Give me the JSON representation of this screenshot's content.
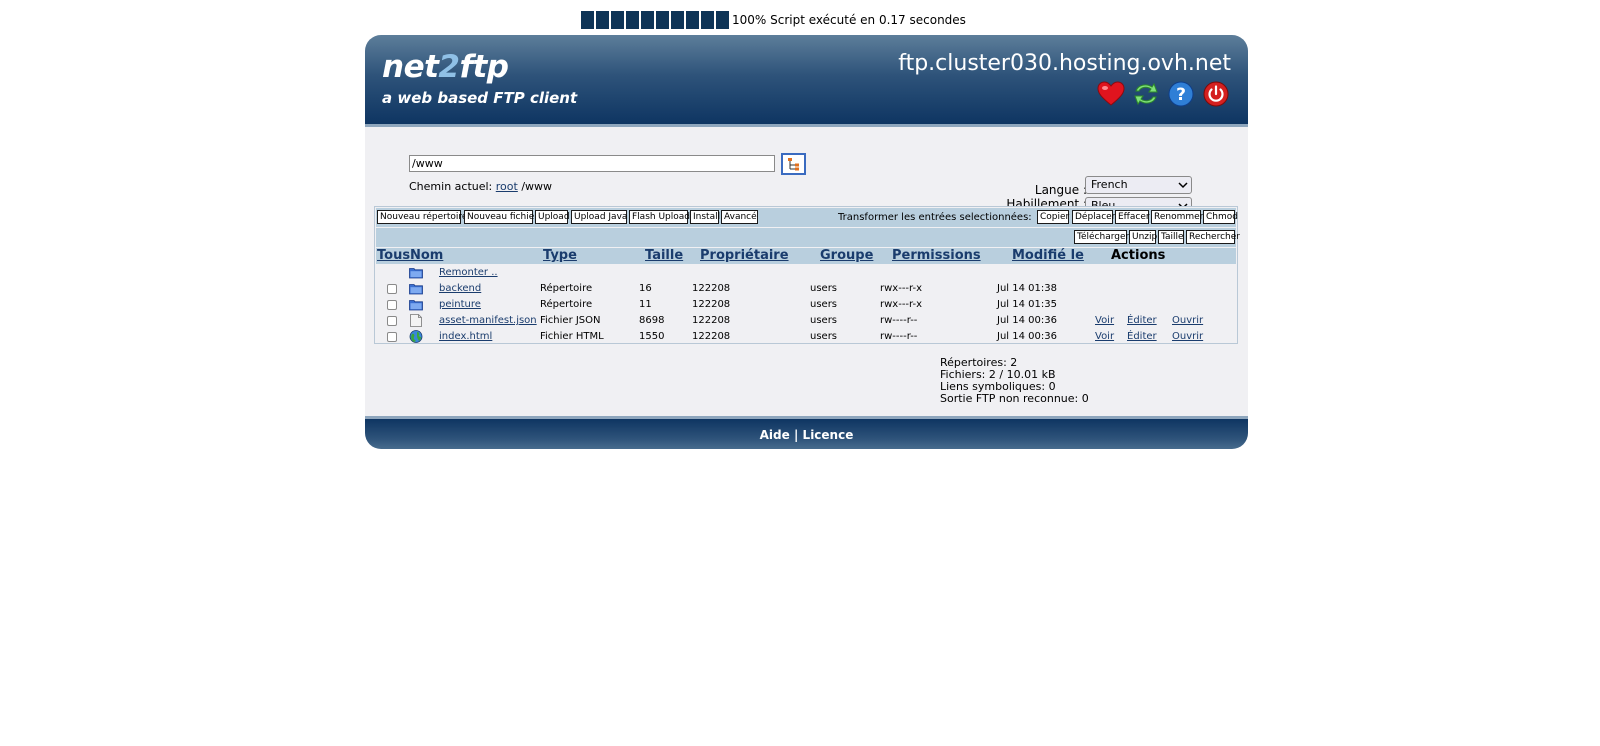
{
  "progress": {
    "blocks": 10,
    "percent_text": "100%",
    "message": "Script exécuté en 0.17 secondes"
  },
  "header": {
    "logo_part1": "net",
    "logo_part2": "2",
    "logo_part3": "ftp",
    "tagline": "a web based FTP client",
    "host": "ftp.cluster030.hosting.ovh.net",
    "icons": [
      "heart-icon",
      "refresh-icon",
      "help-icon",
      "power-icon"
    ]
  },
  "nav": {
    "path_value": "/www",
    "current_path_label": "Chemin actuel:",
    "current_path_root": "root",
    "current_path_rest": "/www"
  },
  "settings": {
    "language_label": "Langue :",
    "language_value": "French",
    "skin_label": "Habillement :",
    "skin_value": "Bleu"
  },
  "toolbar": {
    "new_dir": "Nouveau répertoire",
    "new_file": "Nouveau fichier",
    "upload": "Upload",
    "upload_java": "Upload Java",
    "flash_upload": "Flash Upload",
    "install": "Install",
    "advanced": "Avancé",
    "transform_label": "Transformer les entrées selectionnées:",
    "copy": "Copier",
    "move": "Déplacer",
    "delete": "Effacer",
    "rename": "Renommer",
    "chmod": "Chmod",
    "download": "Télécharger",
    "unzip": "Unzip",
    "size": "Taille",
    "search": "Rechercher"
  },
  "table": {
    "headers": {
      "all": "Tous",
      "name": "Nom",
      "type": "Type",
      "size": "Taille",
      "owner": "Propriétaire",
      "group": "Groupe",
      "permissions": "Permissions",
      "modified": "Modifié le",
      "actions": "Actions"
    },
    "up_label": "Remonter ..",
    "rows": [
      {
        "name": "backend",
        "type": "Répertoire",
        "size": "16",
        "owner": "122208",
        "group": "users",
        "perms": "rwx---r-x",
        "modified": "Jul 14 01:38",
        "icon": "folder-icon"
      },
      {
        "name": "peinture",
        "type": "Répertoire",
        "size": "11",
        "owner": "122208",
        "group": "users",
        "perms": "rwx---r-x",
        "modified": "Jul 14 01:35",
        "icon": "folder-icon"
      },
      {
        "name": "asset-manifest.json",
        "type": "Fichier JSON",
        "size": "8698",
        "owner": "122208",
        "group": "users",
        "perms": "rw----r--",
        "modified": "Jul 14 00:36",
        "icon": "file-icon",
        "view": "Voir",
        "edit": "Éditer",
        "open": "Ouvrir"
      },
      {
        "name": "index.html",
        "type": "Fichier HTML",
        "size": "1550",
        "owner": "122208",
        "group": "users",
        "perms": "rw----r--",
        "modified": "Jul 14 00:36",
        "icon": "globe-icon",
        "view": "Voir",
        "edit": "Éditer",
        "open": "Ouvrir"
      }
    ]
  },
  "stats": {
    "dirs": "Répertoires: 2",
    "files": "Fichiers: 2 / 10.01 kB",
    "symlinks": "Liens symboliques: 0",
    "unrecognized": "Sortie FTP non reconnue: 0"
  },
  "footer": {
    "help": "Aide",
    "separator": "|",
    "license": "Licence"
  }
}
